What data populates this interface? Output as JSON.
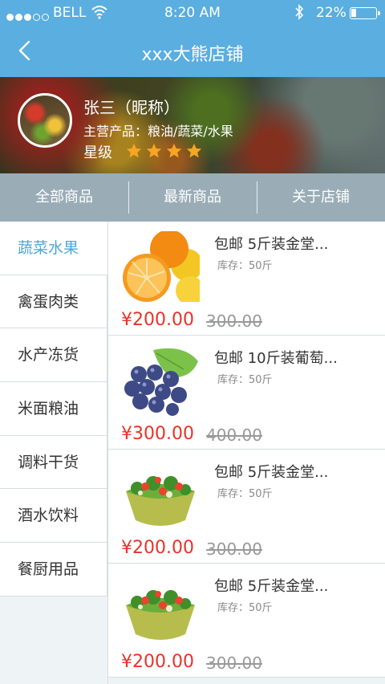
{
  "status_bar": {
    "carrier": "BELL",
    "time": "8:20 AM",
    "battery": "22%",
    "battery_level": 0.22
  },
  "nav": {
    "title": "xxx大熊店铺",
    "back_icon": "chevron-left-icon"
  },
  "shop": {
    "nickname": "张三（昵称）",
    "main_products": "主营产品：粮油/蔬菜/水果",
    "rating_label": "星级",
    "rating_stars": 4,
    "star_color": "#f5a623"
  },
  "tabs": [
    {
      "label": "全部商品"
    },
    {
      "label": "最新商品"
    },
    {
      "label": "关于店铺"
    }
  ],
  "categories": [
    {
      "label": "蔬菜水果",
      "active": true
    },
    {
      "label": "禽蛋肉类"
    },
    {
      "label": "水产冻货"
    },
    {
      "label": "米面粮油"
    },
    {
      "label": "调料干货"
    },
    {
      "label": "酒水饮料"
    },
    {
      "label": "餐厨用品"
    }
  ],
  "products": [
    {
      "name": "包邮 5斤装金堂...",
      "stock": "库存：50斤",
      "price": "¥200.00",
      "old_price": "300.00",
      "image": "oranges"
    },
    {
      "name": "包邮 10斤装葡萄...",
      "stock": "库存：50斤",
      "price": "¥300.00",
      "old_price": "400.00",
      "image": "grapes"
    },
    {
      "name": "包邮 5斤装金堂...",
      "stock": "库存：50斤",
      "price": "¥200.00",
      "old_price": "300.00",
      "image": "salad"
    },
    {
      "name": "包邮 5斤装金堂...",
      "stock": "库存：50斤",
      "price": "¥200.00",
      "old_price": "300.00",
      "image": "salad"
    }
  ],
  "colors": {
    "nav_bg": "#5aaee0",
    "tab_bg": "#9aadb7",
    "accent": "#4ea6dc",
    "price": "#e8332a"
  }
}
